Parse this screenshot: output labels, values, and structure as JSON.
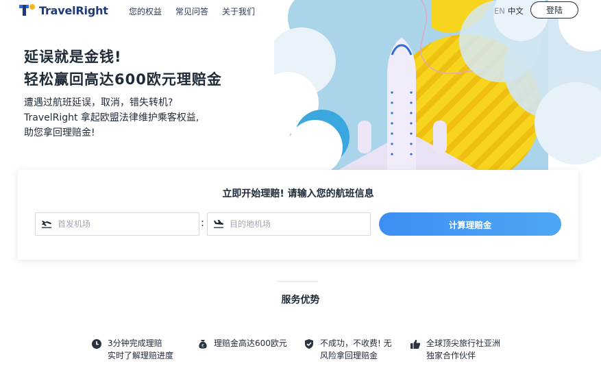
{
  "header": {
    "brand": "TravelRight",
    "nav": [
      {
        "label": "您的权益"
      },
      {
        "label": "常见问答"
      },
      {
        "label": "关于我们"
      }
    ],
    "lang_en": "EN",
    "lang_zh": "中文",
    "login_label": "登陆"
  },
  "hero": {
    "title_line1": "延误就是金钱!",
    "title_line2": "轻松赢回高达600欧元理赔金",
    "sub_line1": "遭遇过航班延误，取消，错失转机?",
    "sub_line2": "TravelRight 拿起欧盟法律维护乘客权益,",
    "sub_line3": "助您拿回理赔金!"
  },
  "search": {
    "title": "立即开始理赔!  请输入您的航班信息",
    "from_placeholder": "首发机场",
    "to_placeholder": "目的地机场",
    "separator": ":",
    "submit_label": "计算理赔金"
  },
  "services": {
    "title": "服务优势",
    "items": [
      {
        "icon": "clock-icon",
        "line1": "3分钟完成理赔",
        "line2": "实时了解理赔进度"
      },
      {
        "icon": "money-bag-icon",
        "line1": "理赔金高达600欧元",
        "line2": ""
      },
      {
        "icon": "shield-check-icon",
        "line1": "不成功，不收费! 无",
        "line2": "风险拿回理赔金"
      },
      {
        "icon": "thumbs-up-icon",
        "line1": "全球顶尖旅行社亚洲",
        "line2": "独家合作伙伴"
      }
    ]
  },
  "colors": {
    "brand_blue": "#1f3a78",
    "accent_blue": "#3d8ef2",
    "sky": "#a9d4ea",
    "yellow": "#f5d21c"
  }
}
